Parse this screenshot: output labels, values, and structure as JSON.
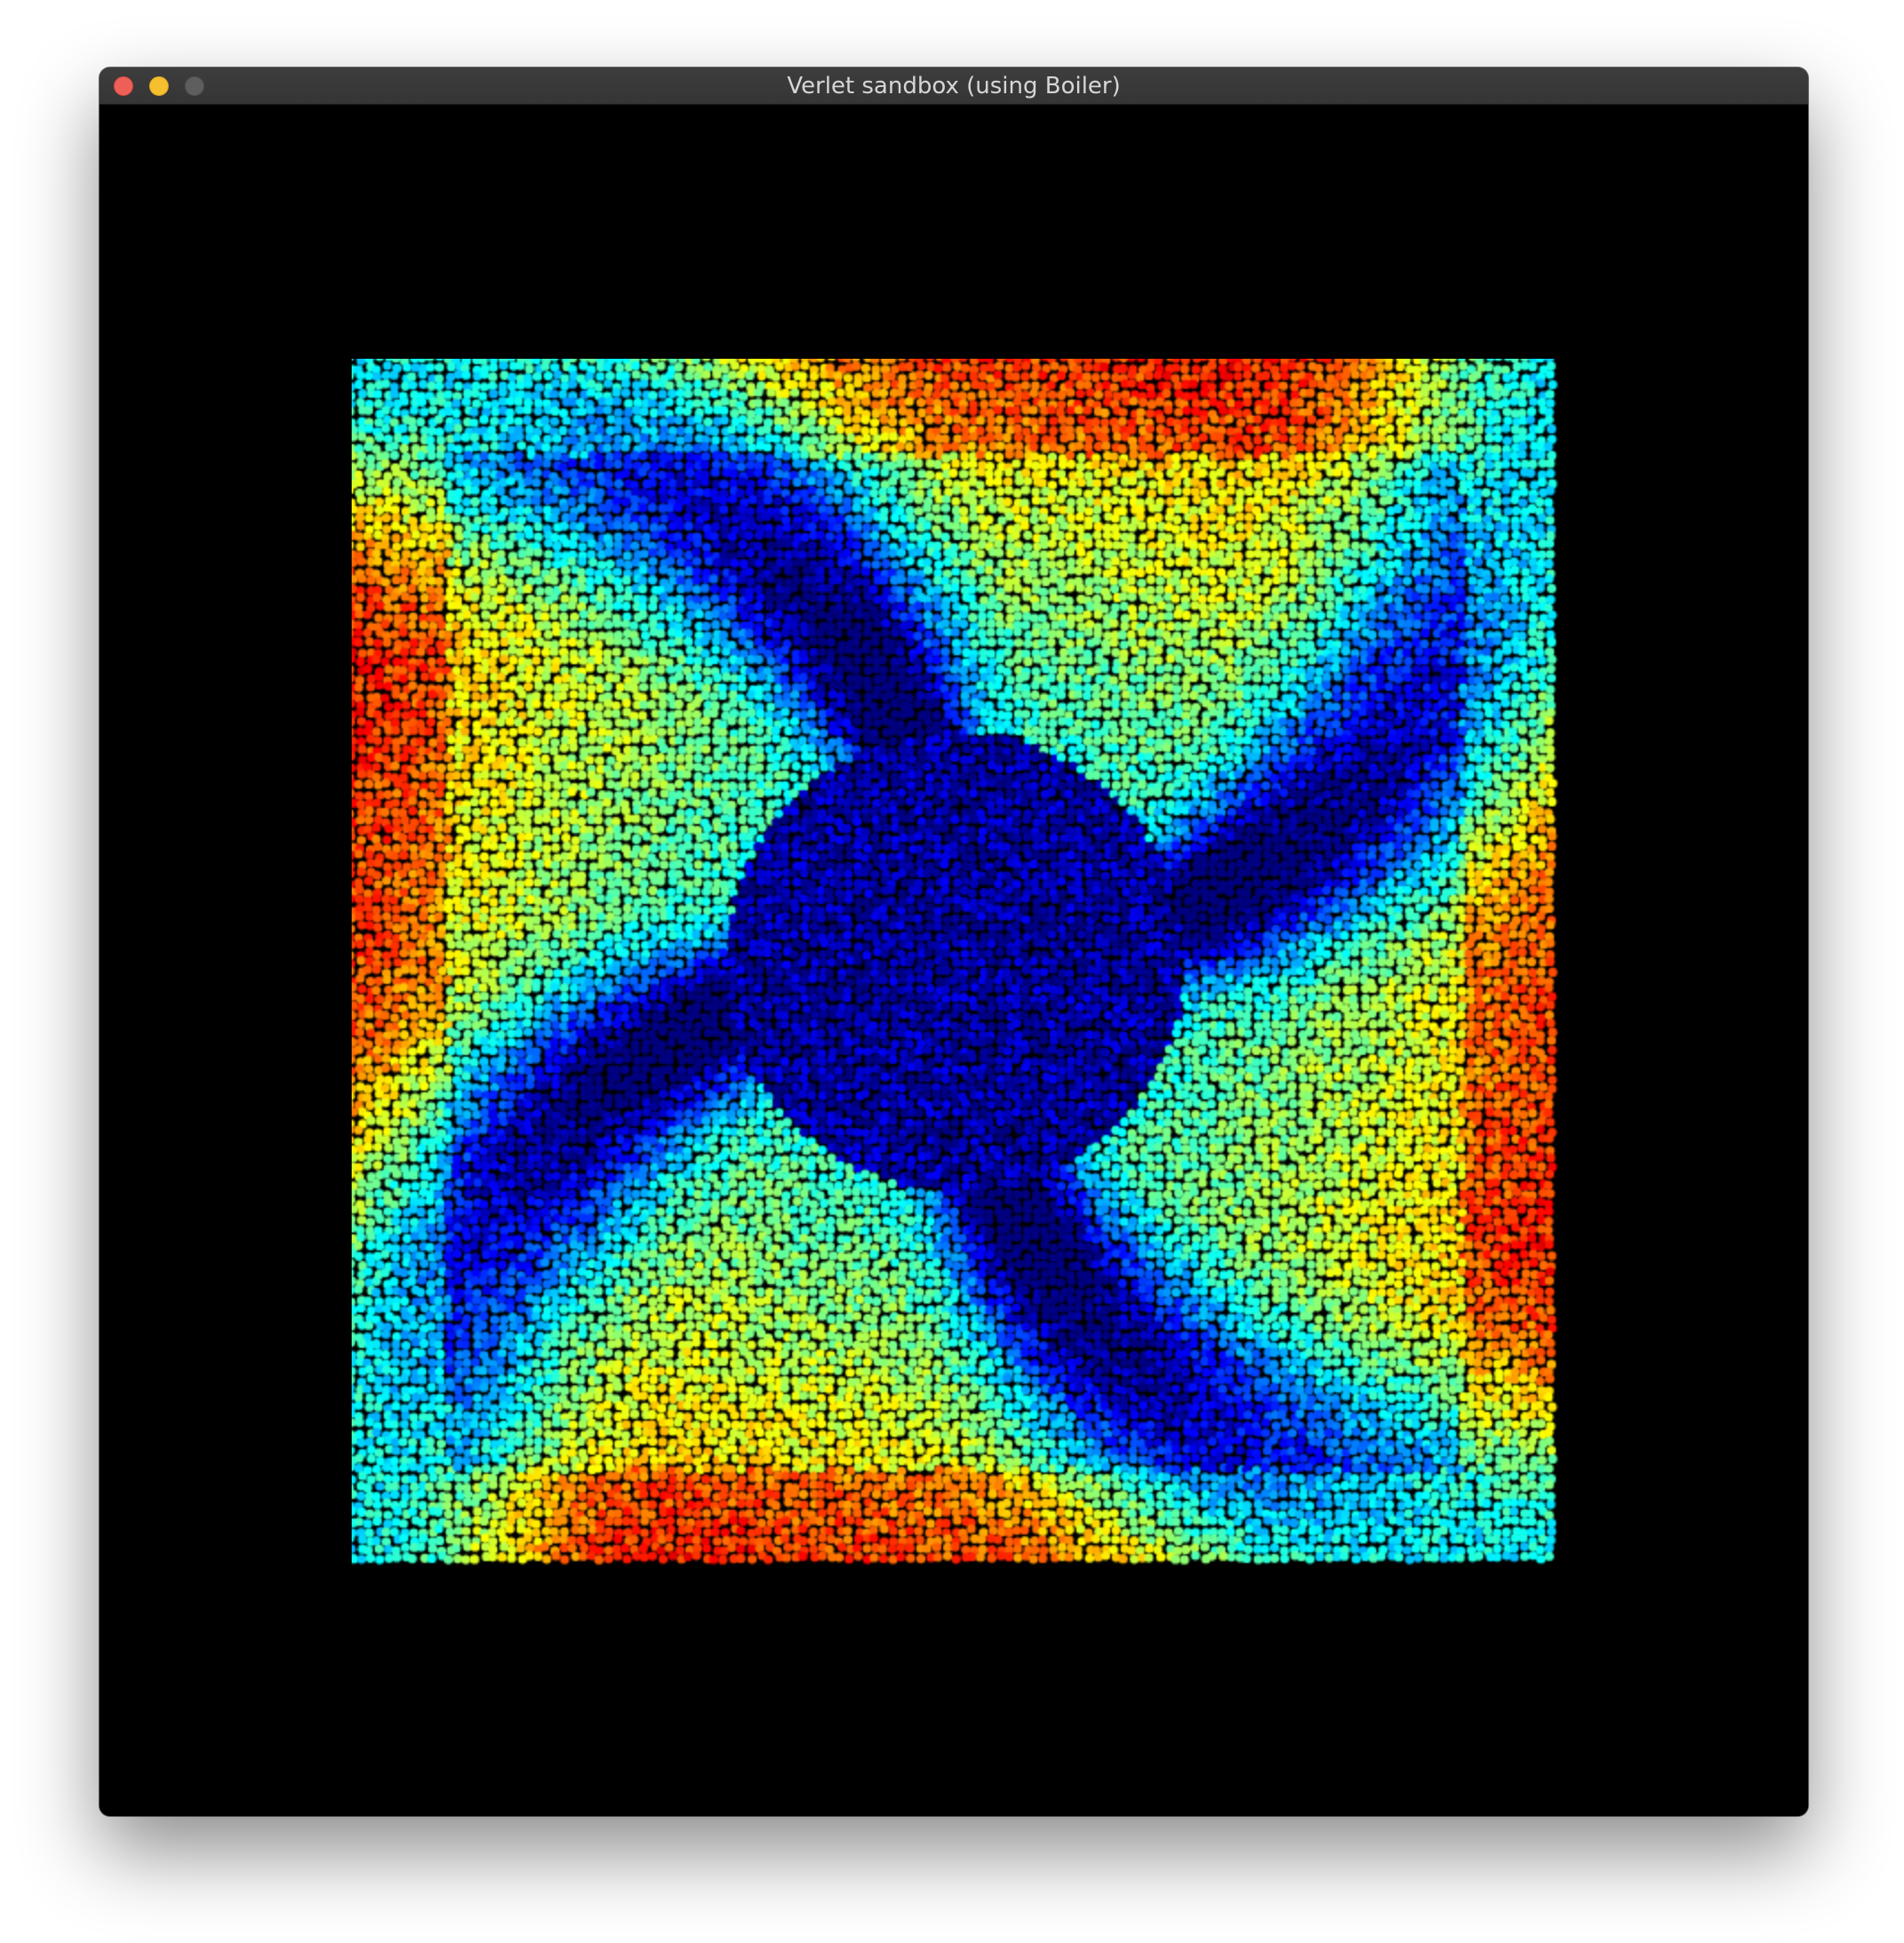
{
  "window": {
    "title": "Verlet sandbox (using Boiler)"
  },
  "simulation": {
    "colormap": "jet",
    "background_color": "#000000"
  }
}
